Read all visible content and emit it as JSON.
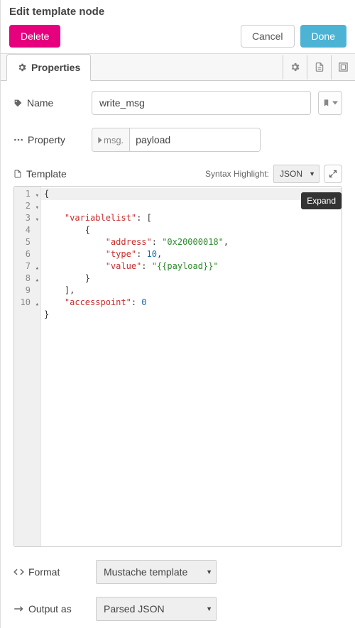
{
  "header": {
    "title": "Edit template node",
    "delete": "Delete",
    "cancel": "Cancel",
    "done": "Done"
  },
  "tabs": {
    "properties": "Properties"
  },
  "form": {
    "nameLabel": "Name",
    "nameValue": "write_msg",
    "propertyLabel": "Property",
    "propertyType": "msg.",
    "propertyValue": "payload",
    "templateLabel": "Template",
    "syntaxLabel": "Syntax Highlight:",
    "syntaxValue": "JSON",
    "expandTooltip": "Expand",
    "formatLabel": "Format",
    "formatValue": "Mustache template",
    "outputLabel": "Output as",
    "outputValue": "Parsed JSON"
  },
  "editor": {
    "lines": [
      "1",
      "2",
      "3",
      "4",
      "5",
      "6",
      "7",
      "8",
      "9",
      "10"
    ],
    "fold": [
      "1",
      "2",
      "3",
      "7",
      "8",
      "10"
    ],
    "tokens": {
      "brace_open": "{",
      "brace_close": "}",
      "bracket_open": "[",
      "bracket_close": "]",
      "varlist": "\"variablelist\"",
      "address_k": "\"address\"",
      "address_v": "\"0x20000018\"",
      "type_k": "\"type\"",
      "type_v": "10",
      "value_k": "\"value\"",
      "value_v": "\"{{payload}}\"",
      "accesspoint_k": "\"accesspoint\"",
      "accesspoint_v": "0"
    }
  }
}
